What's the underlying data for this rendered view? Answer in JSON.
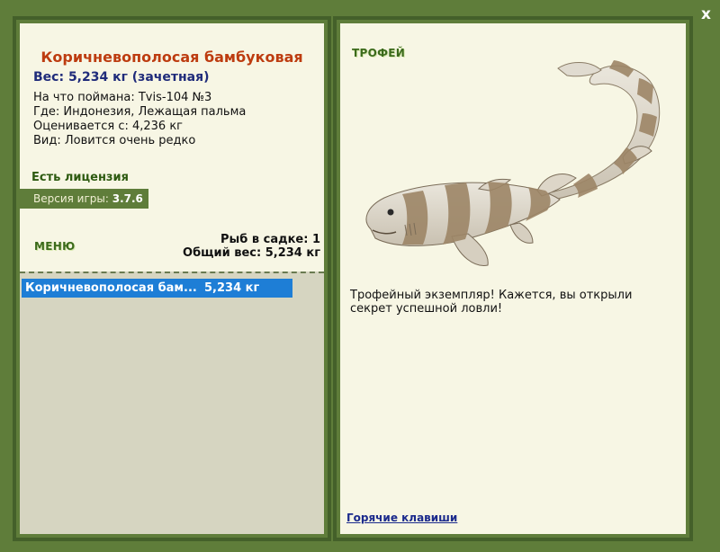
{
  "window": {
    "close_label": "x"
  },
  "fish": {
    "title": "Коричневополосая бамбуковая",
    "weight": "Вес: 5,234 кг (зачетная)",
    "info": [
      "На что поймана: Tvis-104 №3",
      "Где: Индонезия, Лежащая пальма",
      "Оценивается с: 4,236 кг",
      "Вид: Ловится очень редко"
    ]
  },
  "license": "Есть лицензия",
  "version": {
    "label": "Версия игры:",
    "value": "3.7.6"
  },
  "menu_label": "МЕНЮ",
  "stats": {
    "fish_count": "Рыб в садке: 1",
    "total_weight": "Общий вес: 5,234 кг"
  },
  "catch_list": [
    {
      "name": "Коричневополосая бам...",
      "weight": "5,234 кг"
    }
  ],
  "trophy": {
    "label": "ТРОФЕЙ",
    "message": "Трофейный экземпляр! Кажется, вы открыли секрет успешной ловли!"
  },
  "hotkeys_link": "Горячие клавиши",
  "colors": {
    "frame_green": "#5f7d3a",
    "panel_bg": "#f7f6e4",
    "title_orange": "#bd3c10",
    "weight_blue": "#1f2b7a",
    "selection_blue": "#1e7ed6"
  }
}
